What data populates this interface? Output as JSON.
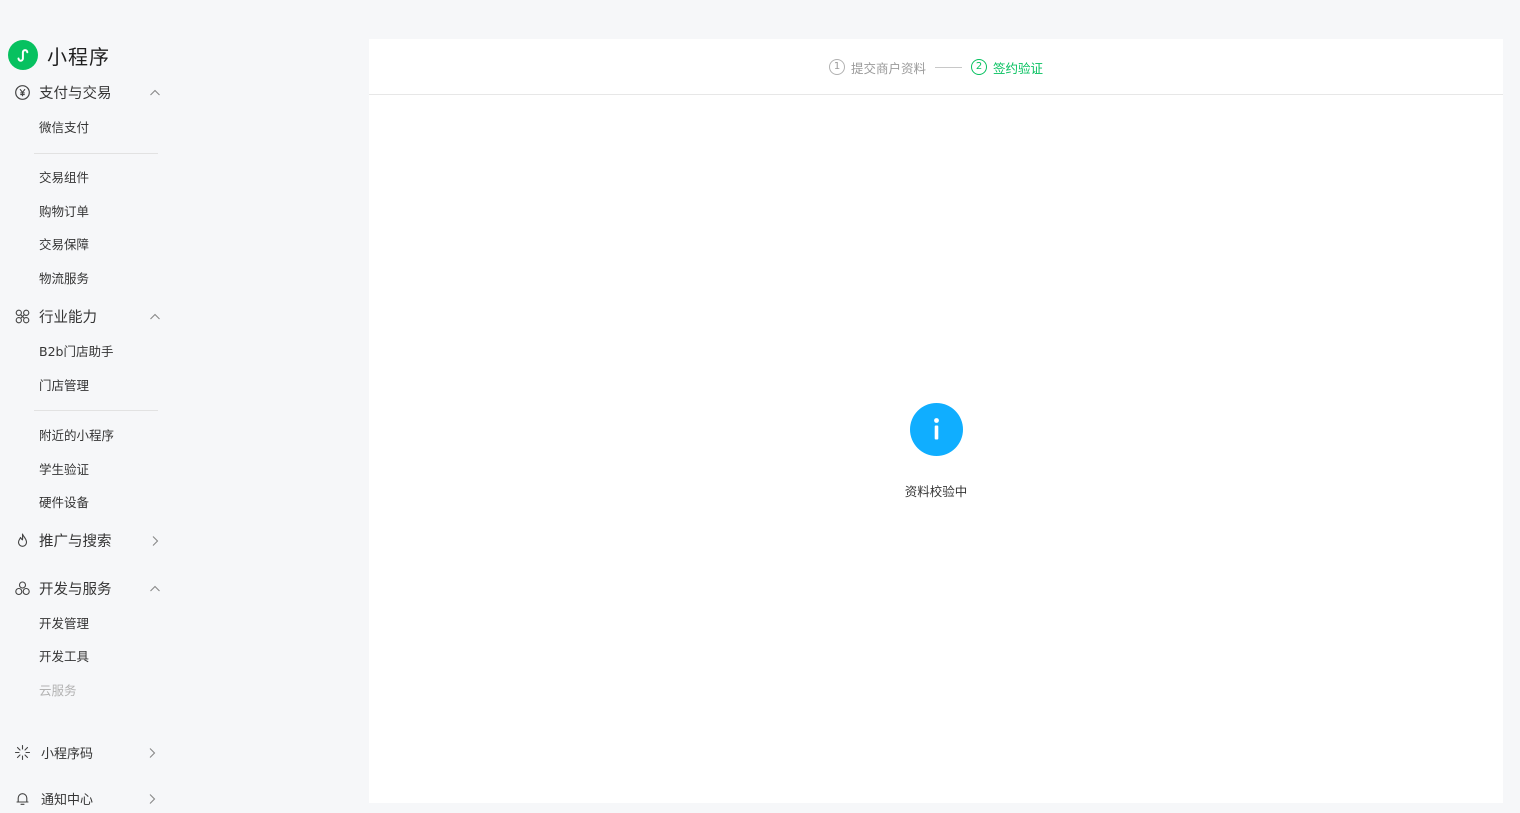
{
  "brand": {
    "title": "小程序",
    "icon": "mini-program-logo-icon",
    "color": "#07c160"
  },
  "sidebar": {
    "groups": [
      {
        "label": "支付与交易",
        "icon": "yen-circle-icon",
        "chevron": "chevron-up-icon",
        "items": [
          "微信支付",
          "交易组件",
          "购物订单",
          "交易保障",
          "物流服务"
        ]
      },
      {
        "label": "行业能力",
        "icon": "industry-icon",
        "chevron": "chevron-up-icon",
        "items": [
          "B2b门店助手",
          "门店管理",
          "附近的小程序",
          "学生验证",
          "硬件设备"
        ]
      },
      {
        "label": "推广与搜索",
        "icon": "promotion-icon",
        "chevron": "chevron-right-icon",
        "items": []
      },
      {
        "label": "开发与服务",
        "icon": "develop-icon",
        "chevron": "chevron-up-icon",
        "items": [
          "开发管理",
          "开发工具",
          "云服务"
        ]
      },
      {
        "label": "小程序码",
        "icon": "qrcode-sun-icon",
        "chevron": "chevron-right-icon",
        "items": []
      },
      {
        "label": "通知中心",
        "icon": "bell-icon",
        "chevron": "chevron-right-icon",
        "items": []
      }
    ]
  },
  "steps": [
    {
      "number": "1",
      "label": "提交商户资料",
      "state": "done"
    },
    {
      "number": "2",
      "label": "签约验证",
      "state": "active"
    }
  ],
  "status": {
    "icon": "info-icon",
    "text": "资料校验中",
    "color": "#10aeff"
  }
}
